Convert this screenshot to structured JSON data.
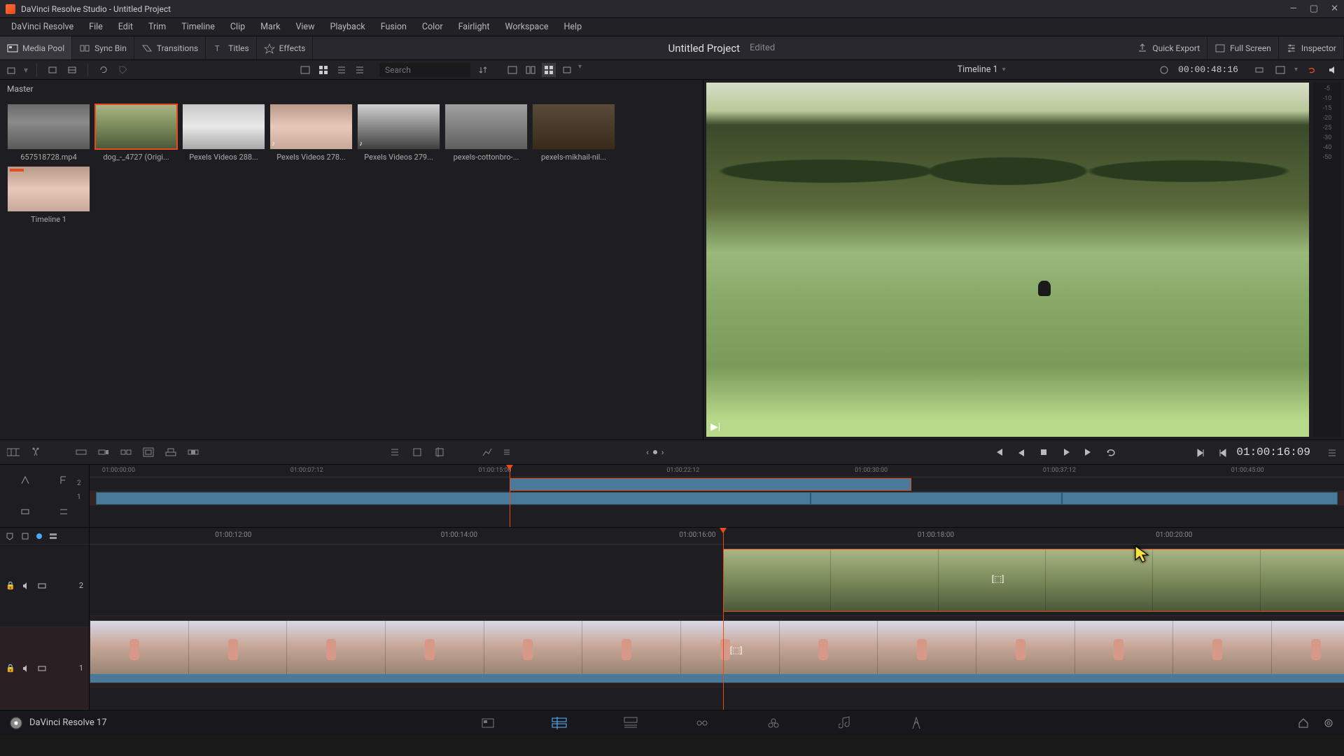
{
  "titlebar": {
    "text": "DaVinci Resolve Studio - Untitled Project"
  },
  "menu": [
    "DaVinci Resolve",
    "File",
    "Edit",
    "Trim",
    "Timeline",
    "Clip",
    "Mark",
    "View",
    "Playback",
    "Fusion",
    "Color",
    "Fairlight",
    "Workspace",
    "Help"
  ],
  "toolbar": {
    "mediapool": "Media Pool",
    "syncbin": "Sync Bin",
    "transitions": "Transitions",
    "titles": "Titles",
    "effects": "Effects",
    "project": "Untitled Project",
    "edited": "Edited",
    "quickexport": "Quick Export",
    "fullscreen": "Full Screen",
    "inspector": "Inspector"
  },
  "sec": {
    "search_ph": "Search",
    "timeline_name": "Timeline 1",
    "record_tc": "00:00:48:16"
  },
  "master_label": "Master",
  "clips": [
    {
      "name": "657518728.mp4"
    },
    {
      "name": "dog_-_4727 (Origi..."
    },
    {
      "name": "Pexels Videos 288..."
    },
    {
      "name": "Pexels Videos 278..."
    },
    {
      "name": "Pexels Videos 279..."
    },
    {
      "name": "pexels-cottonbro-..."
    },
    {
      "name": "pexels-mikhail-nil..."
    },
    {
      "name": "Timeline 1"
    }
  ],
  "mini_ruler": [
    "01:00:00:00",
    "01:00:07:12",
    "01:00:15:00",
    "01:00:22:12",
    "01:00:30:00",
    "01:00:37:12",
    "01:00:45:00"
  ],
  "main_ruler": [
    "01:00:12:00",
    "01:00:14:00",
    "01:00:16:00",
    "01:00:18:00",
    "01:00:20:00"
  ],
  "transport_tc": "01:00:16:09",
  "bottom": {
    "app": "DaVinci Resolve 17"
  },
  "track_nums": {
    "t2": "2",
    "t1": "1"
  },
  "meter_ticks": [
    "-5",
    "-10",
    "-15",
    "-20",
    "-25",
    "-30",
    "-40",
    "-50"
  ]
}
